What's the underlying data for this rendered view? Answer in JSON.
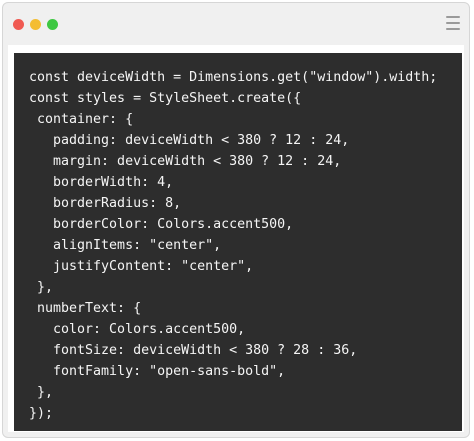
{
  "window": {
    "controls": [
      {
        "name": "close",
        "color": "#f05a52"
      },
      {
        "name": "minimize",
        "color": "#f4bd31"
      },
      {
        "name": "zoom",
        "color": "#3ec842"
      }
    ],
    "menu_icon": "hamburger-menu-icon"
  },
  "code": {
    "lines": [
      "const deviceWidth = Dimensions.get(\"window\").width;",
      "const styles = StyleSheet.create({",
      " container: {",
      "   padding: deviceWidth < 380 ? 12 : 24,",
      "   margin: deviceWidth < 380 ? 12 : 24,",
      "   borderWidth: 4,",
      "   borderRadius: 8,",
      "   borderColor: Colors.accent500,",
      "   alignItems: \"center\",",
      "   justifyContent: \"center\",",
      " },",
      " numberText: {",
      "   color: Colors.accent500,",
      "   fontSize: deviceWidth < 380 ? 28 : 36,",
      "   fontFamily: \"open-sans-bold\",",
      " },",
      "});"
    ]
  }
}
